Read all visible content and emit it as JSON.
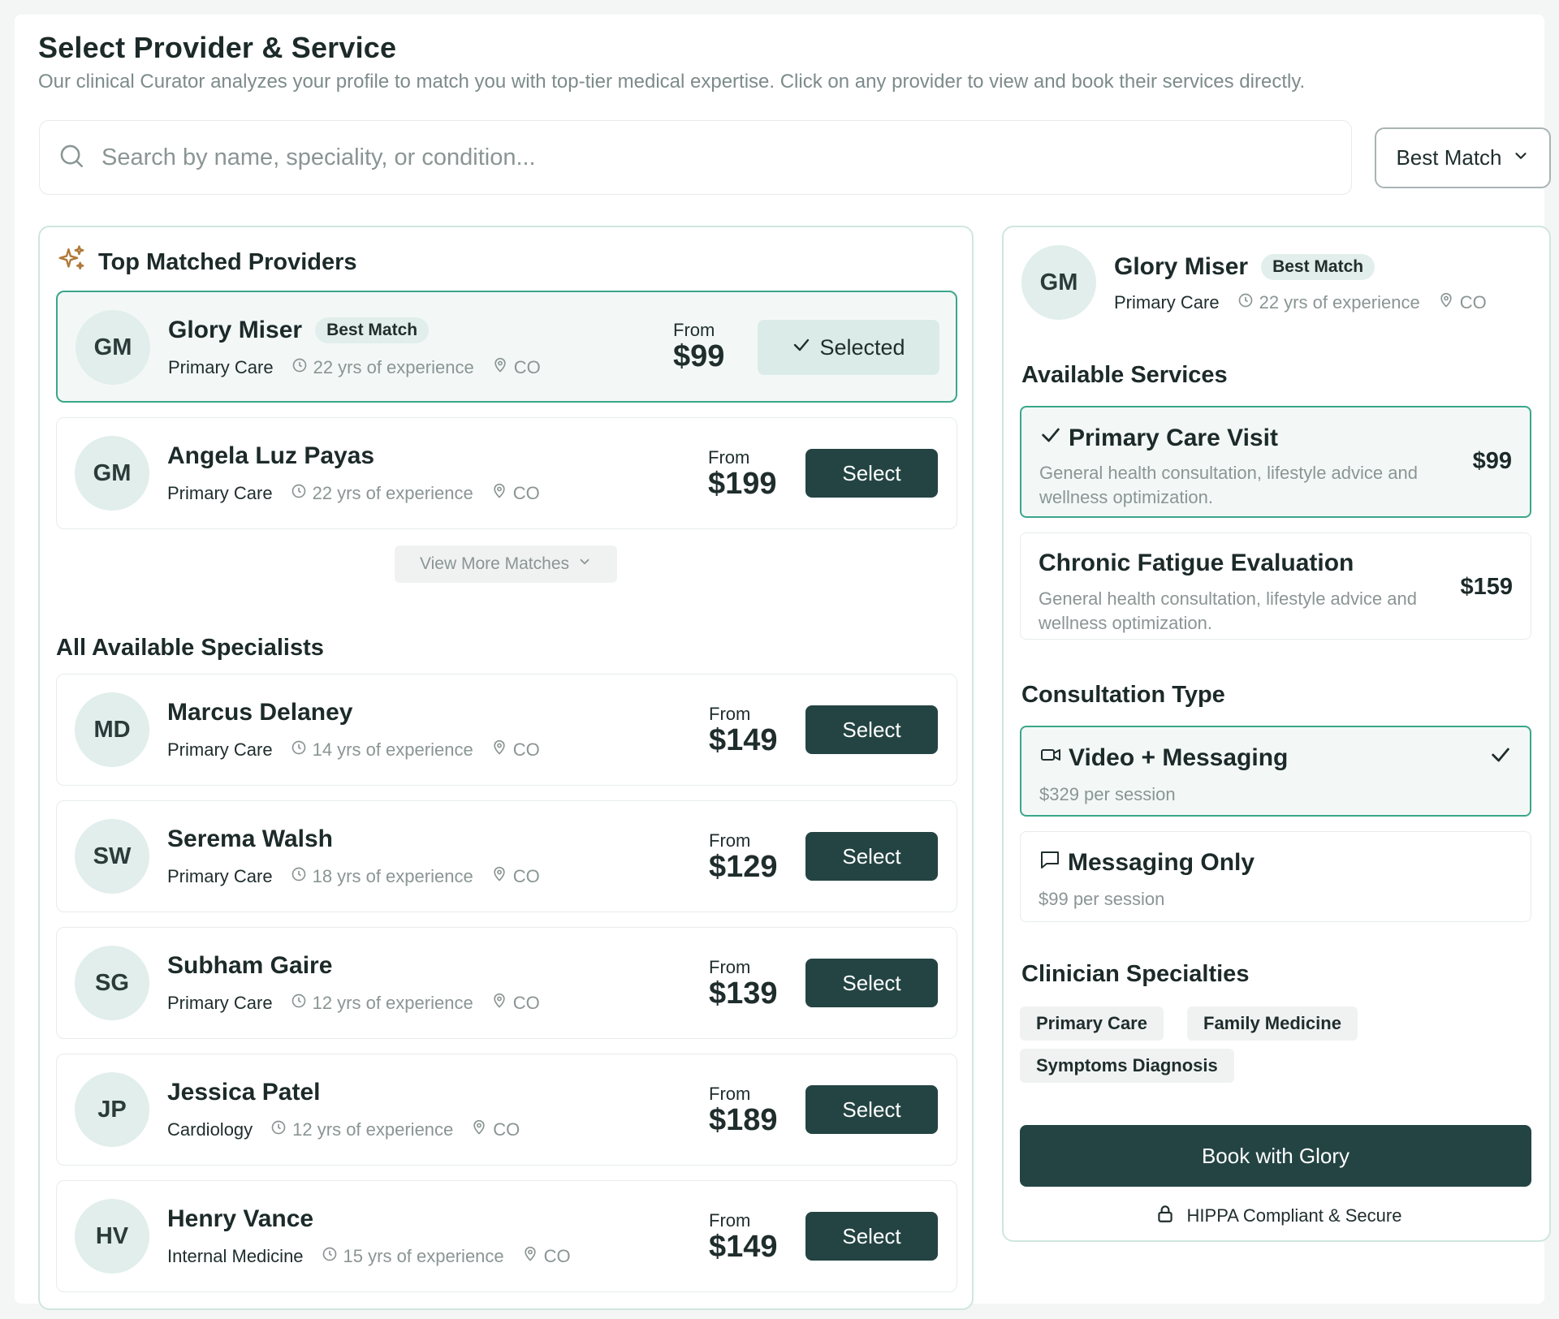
{
  "header": {
    "title": "Select Provider & Service",
    "subtitle": "Our clinical Curator analyzes your profile to match you with top-tier medical expertise. Click on any provider to view and book their services directly."
  },
  "search": {
    "placeholder": "Search by name, speciality, or condition...",
    "icon": "search-icon"
  },
  "sort": {
    "label": "Best Match"
  },
  "top_matched": {
    "heading": "Top Matched Providers",
    "providers": [
      {
        "initials": "GM",
        "name": "Glory Miser",
        "badge": "Best Match",
        "specialty": "Primary Care",
        "experience": "22 yrs of experience",
        "location": "CO",
        "from": "From",
        "price": "$99",
        "action": "Selected",
        "selected": true
      },
      {
        "initials": "GM",
        "name": "Angela Luz Payas",
        "specialty": "Primary Care",
        "experience": "22 yrs of experience",
        "location": "CO",
        "from": "From",
        "price": "$199",
        "action": "Select",
        "selected": false
      }
    ],
    "view_more": "View More Matches"
  },
  "all_specialists": {
    "heading": "All Available Specialists",
    "providers": [
      {
        "initials": "MD",
        "name": "Marcus Delaney",
        "specialty": "Primary Care",
        "experience": "14 yrs of experience",
        "location": "CO",
        "from": "From",
        "price": "$149",
        "action": "Select"
      },
      {
        "initials": "SW",
        "name": "Serema Walsh",
        "specialty": "Primary Care",
        "experience": "18 yrs of experience",
        "location": "CO",
        "from": "From",
        "price": "$129",
        "action": "Select"
      },
      {
        "initials": "SG",
        "name": "Subham Gaire",
        "specialty": "Primary Care",
        "experience": "12 yrs of experience",
        "location": "CO",
        "from": "From",
        "price": "$139",
        "action": "Select"
      },
      {
        "initials": "JP",
        "name": "Jessica Patel",
        "specialty": "Cardiology",
        "experience": "12 yrs of experience",
        "location": "CO",
        "from": "From",
        "price": "$189",
        "action": "Select"
      },
      {
        "initials": "HV",
        "name": "Henry Vance",
        "specialty": "Internal Medicine",
        "experience": "15 yrs of experience",
        "location": "CO",
        "from": "From",
        "price": "$149",
        "action": "Select"
      }
    ]
  },
  "detail": {
    "initials": "GM",
    "name": "Glory Miser",
    "badge": "Best Match",
    "specialty": "Primary Care",
    "experience": "22 yrs of experience",
    "location": "CO",
    "services_heading": "Available Services",
    "services": [
      {
        "title": "Primary Care Visit",
        "description": "General health consultation, lifestyle advice and wellness optimization.",
        "price": "$99",
        "selected": true
      },
      {
        "title": "Chronic Fatigue Evaluation",
        "description": "General health consultation, lifestyle advice and wellness optimization.",
        "price": "$159",
        "selected": false
      }
    ],
    "consultation_heading": "Consultation Type",
    "consultation_types": [
      {
        "title": "Video + Messaging",
        "price_note": "$329 per session",
        "icon": "video-icon",
        "selected": true
      },
      {
        "title": "Messaging Only",
        "price_note": "$99 per session",
        "icon": "message-icon",
        "selected": false
      }
    ],
    "specialties_heading": "Clinician Specialties",
    "specialties": [
      "Primary Care",
      "Family Medicine",
      "Symptoms Diagnosis"
    ],
    "book_label": "Book with Glory",
    "secure_note": "HIPPA Compliant & Secure"
  },
  "colors": {
    "primary_dark": "#234443",
    "accent_green": "#3aa68a",
    "avatar_bg": "#e1eeeb",
    "muted_text": "#8a9594"
  }
}
